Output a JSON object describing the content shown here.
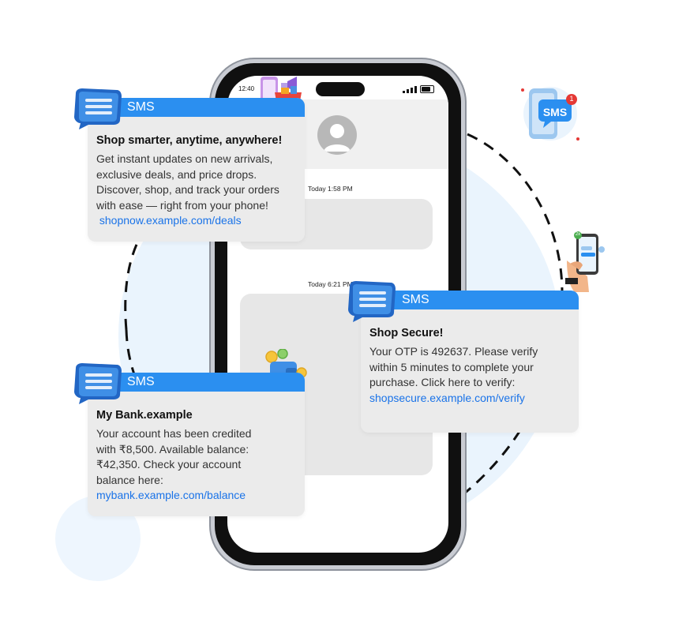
{
  "phone": {
    "status_time": "12:40",
    "messages": [
      {
        "time": "Today 1:58 PM"
      },
      {
        "time": "Today 6:21 PM"
      }
    ]
  },
  "cards": [
    {
      "header": "SMS",
      "title": "Shop smarter, anytime, anywhere!",
      "lines": [
        "Get instant updates on new arrivals,",
        "exclusive deals, and price drops.",
        "Discover, shop, and track your orders",
        "with ease — right from your phone!"
      ],
      "link": " shopnow.example.com/deals"
    },
    {
      "header": "SMS",
      "title": "My Bank.example",
      "lines": [
        "Your account has been credited",
        "with ₹8,500. Available balance:",
        "₹42,350. Check your account",
        "balance here:"
      ],
      "link": "mybank.example.com/balance"
    },
    {
      "header": "SMS",
      "title": "Shop Secure!",
      "lines": [
        "Your OTP is 492637. Please verify",
        "within 5 minutes to complete your",
        "purchase. Click here to verify:"
      ],
      "link": "shopsecure.example.com/verify"
    }
  ],
  "badge": {
    "label": "SMS",
    "count": "1"
  },
  "hand_phone_badge": "2x",
  "colors": {
    "accent": "#2b8ff0",
    "link": "#1a73e8",
    "card_bg": "#ebebeb",
    "badge_red": "#e53935"
  }
}
